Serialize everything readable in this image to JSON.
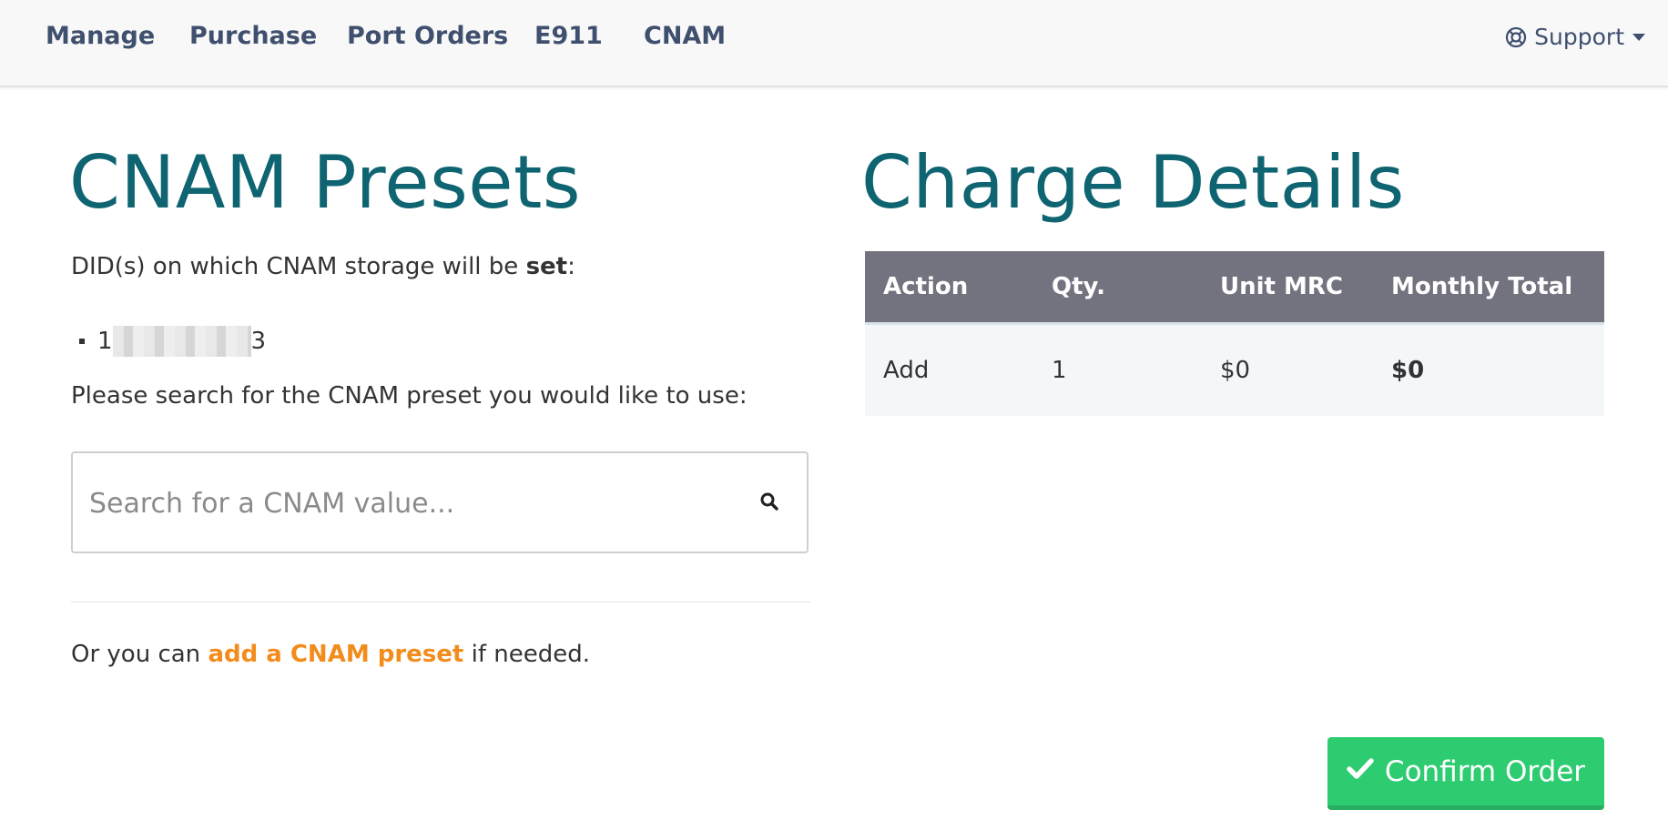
{
  "nav": {
    "items": [
      "Manage",
      "Purchase",
      "Port Orders",
      "E911",
      "CNAM"
    ],
    "support": "Support"
  },
  "left": {
    "title": "CNAM Presets",
    "did_intro_prefix": "DID(s) on which CNAM storage will be ",
    "did_intro_bold": "set",
    "did_intro_suffix": ":",
    "did_visible_first": "1",
    "did_visible_last": "3",
    "search_prompt": "Please search for the CNAM preset you would like to use:",
    "search_placeholder": "Search for a CNAM value...",
    "footer_prefix": "Or you can ",
    "footer_link": "add a CNAM preset",
    "footer_suffix": " if needed."
  },
  "right": {
    "title": "Charge Details",
    "columns": [
      "Action",
      "Qty.",
      "Unit MRC",
      "Monthly Total"
    ],
    "rows": [
      {
        "action": "Add",
        "qty": "1",
        "unit_mrc": "$0",
        "monthly_total": "$0"
      }
    ]
  },
  "confirm_button": "Confirm Order",
  "colors": {
    "nav_text": "#3f4f6e",
    "heading": "#0e6470",
    "link": "#f28c1c",
    "table_header": "#737380",
    "confirm": "#2ecc71"
  },
  "icons": {
    "support": "lifebuoy-icon",
    "caret": "caret-down-icon",
    "search": "search-icon",
    "confirm": "check-icon"
  }
}
